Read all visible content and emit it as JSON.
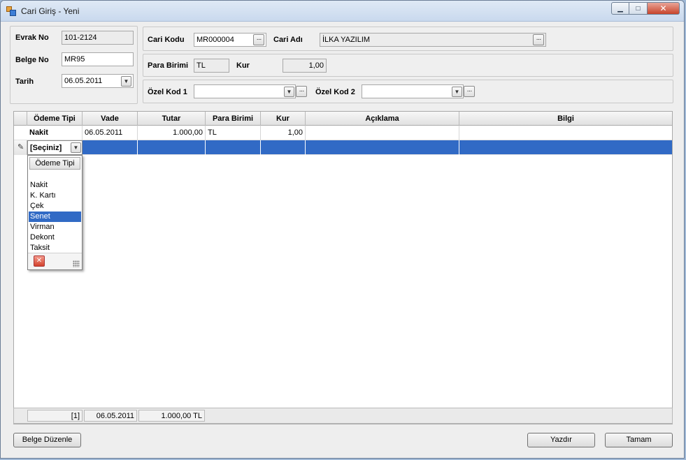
{
  "window": {
    "title": "Cari Giriş - Yeni",
    "controls": {
      "minimize": "▁",
      "maximize": "□",
      "close": "✕"
    }
  },
  "doc": {
    "evrak_no_label": "Evrak No",
    "evrak_no_value": "101-2124",
    "belge_no_label": "Belge No",
    "belge_no_value": "MR95",
    "tarih_label": "Tarih",
    "tarih_value": "06.05.2011"
  },
  "cari": {
    "kodu_label": "Cari Kodu",
    "kodu_value": "MR000004",
    "adi_label": "Cari Adı",
    "adi_value": "İLKA YAZILIM",
    "para_birimi_label": "Para Birimi",
    "para_birimi_value": "TL",
    "kur_label": "Kur",
    "kur_value": "1,00",
    "ozel_kod1_label": "Özel Kod 1",
    "ozel_kod1_value": "",
    "ozel_kod2_label": "Özel Kod 2",
    "ozel_kod2_value": ""
  },
  "grid": {
    "columns": [
      "Ödeme Tipi",
      "Vade",
      "Tutar",
      "Para Birimi",
      "Kur",
      "Açıklama",
      "Bilgi"
    ],
    "rows": [
      {
        "odeme_tipi": "Nakit",
        "vade": "06.05.2011",
        "tutar": "1.000,00",
        "para_birimi": "TL",
        "kur": "1,00",
        "aciklama": "",
        "bilgi": ""
      }
    ],
    "editing_row": {
      "odeme_tipi": "[Seçiniz]"
    }
  },
  "popup": {
    "header": "Ödeme Tipi",
    "items": [
      "",
      "Nakit",
      "K. Kartı",
      "Çek",
      "Senet",
      "Virman",
      "Dekont",
      "Taksit"
    ],
    "highlighted": "Senet"
  },
  "footer": {
    "count": "[1]",
    "date": "06.05.2011",
    "total": "1.000,00 TL"
  },
  "buttons": {
    "belge_duzenle": "Belge Düzenle",
    "yazdir": "Yazdır",
    "tamam": "Tamam"
  },
  "colors": {
    "selection": "#316ac5",
    "window_bg": "#eeeeee"
  }
}
